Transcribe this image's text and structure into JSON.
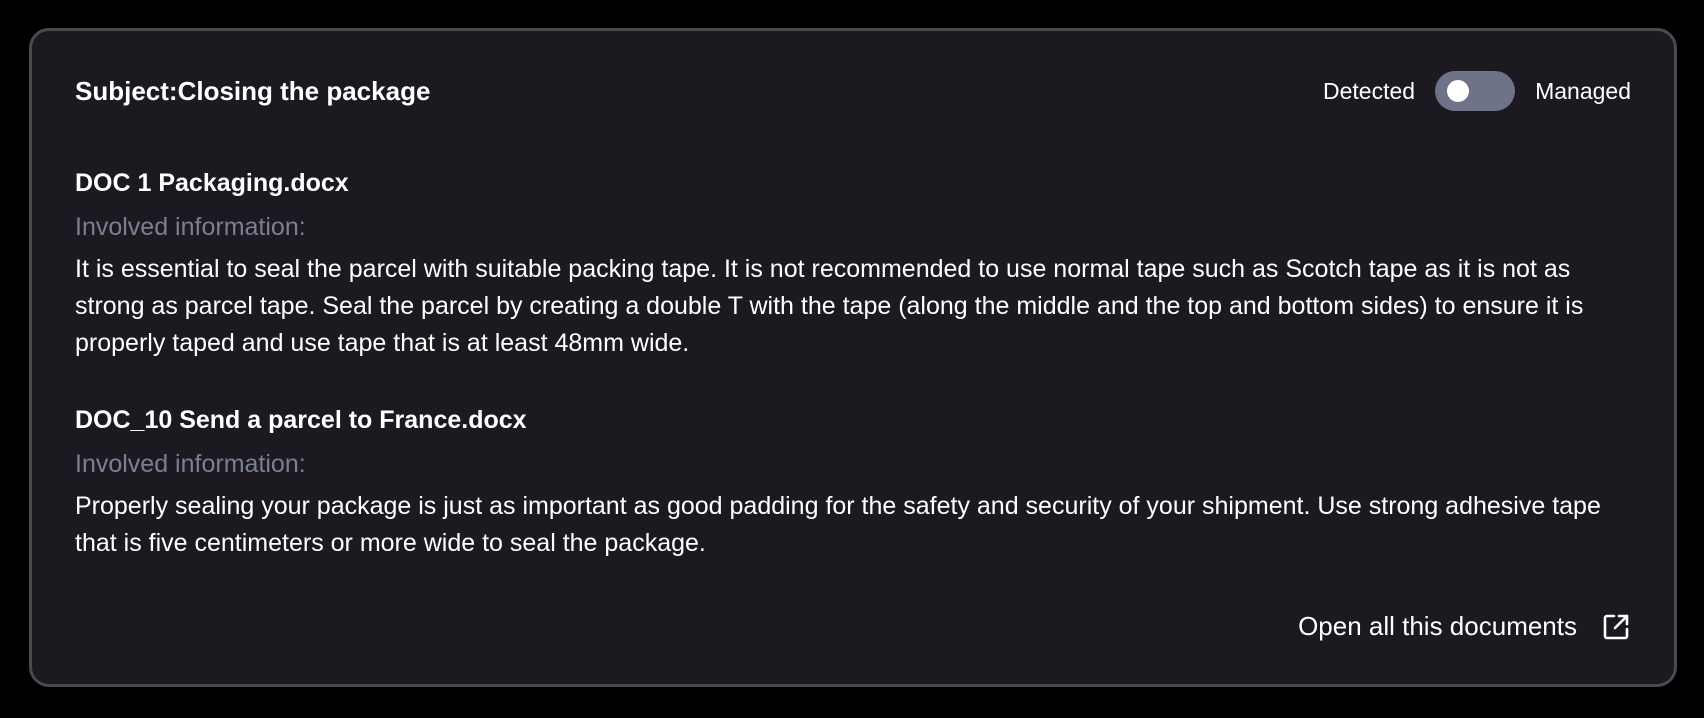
{
  "header": {
    "subject": "Subject:Closing the package",
    "toggle_left_label": "Detected",
    "toggle_right_label": "Managed"
  },
  "documents": [
    {
      "title": "DOC 1 Packaging.docx",
      "label": "Involved information:",
      "text": "It is essential to seal the parcel with suitable packing tape. It is not recommended to use normal tape such as Scotch tape as it is not as strong as parcel tape. Seal the parcel by creating a double T with the tape (along the middle and the top and bottom sides) to ensure it is properly taped and use tape that is at least 48mm wide."
    },
    {
      "title": "DOC_10 Send a parcel to France.docx",
      "label": "Involved information:",
      "text": "Properly sealing your package is just as important as good padding for the safety and security of your shipment. Use strong adhesive tape that is five centimeters or more wide to seal the package."
    }
  ],
  "footer": {
    "open_all_label": "Open all this documents",
    "open_all_icon": "external-link-icon"
  },
  "colors": {
    "card_background": "#1c1a20",
    "card_border": "#4a4950",
    "muted_label": "#7b7f94",
    "toggle_track": "#6f7389"
  }
}
